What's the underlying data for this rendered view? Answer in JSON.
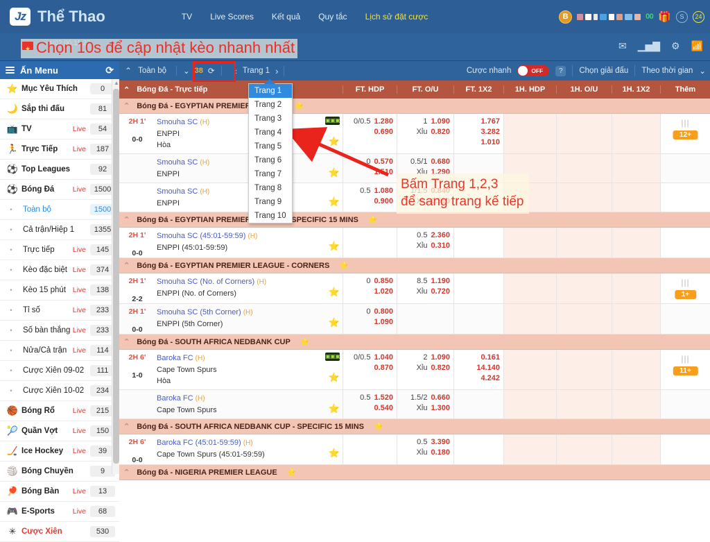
{
  "header": {
    "brand": "Thể Thao",
    "logo_text": "Jz",
    "nav": [
      {
        "label": "TV",
        "highlight": false
      },
      {
        "label": "Live Scores",
        "highlight": false
      },
      {
        "label": "Kết quả",
        "highlight": false
      },
      {
        "label": "Quy tắc",
        "highlight": false
      },
      {
        "label": "Lịch sử đặt cược",
        "highlight": true
      }
    ],
    "coin_letter": "B",
    "amount": "00",
    "icons": [
      "gift-icon",
      "s-circle-icon",
      "24-circle-icon"
    ],
    "clock": "4/02 00:11:27",
    "sub_icons": [
      "mail-icon",
      "stats-icon",
      "gear-icon",
      "wifi-icon"
    ]
  },
  "annotations": {
    "top": "Chọn 10s để cập nhật kèo nhanh nhất",
    "middle_line1": "Bấm Trang 1,2,3",
    "middle_line2": "để sang trang kế tiếp"
  },
  "sidebar": {
    "title": "Ấn Menu",
    "refresh_icon": "refresh-icon",
    "items": [
      {
        "icon": "star-icon",
        "label": "Mục Yêu Thích",
        "live": "",
        "count": "0",
        "sub": false
      },
      {
        "icon": "clock-icon",
        "label": "Sắp thi đấu",
        "live": "",
        "count": "81",
        "sub": false
      },
      {
        "icon": "tv-icon",
        "label": "TV",
        "live": "Live",
        "count": "54",
        "sub": false
      },
      {
        "icon": "running-icon",
        "label": "Trực Tiếp",
        "live": "Live",
        "count": "187",
        "sub": false
      },
      {
        "icon": "trophy-icon",
        "label": "Top Leagues",
        "live": "",
        "count": "92",
        "sub": false
      },
      {
        "icon": "soccer-icon",
        "label": "Bóng Đá",
        "live": "Live",
        "count": "1500",
        "sub": false
      },
      {
        "icon": "dot-icon",
        "label": "Toàn bộ",
        "live": "",
        "count": "1500",
        "sub": true,
        "active": true
      },
      {
        "icon": "dot-icon",
        "label": "Cả trận/Hiệp 1",
        "live": "",
        "count": "1355",
        "sub": true
      },
      {
        "icon": "dot-icon",
        "label": "Trực tiếp",
        "live": "Live",
        "count": "145",
        "sub": true
      },
      {
        "icon": "dot-icon",
        "label": "Kèo đặc biệt",
        "live": "Live",
        "count": "374",
        "sub": true
      },
      {
        "icon": "dot-icon",
        "label": "Kèo 15 phút",
        "live": "Live",
        "count": "138",
        "sub": true
      },
      {
        "icon": "dot-icon",
        "label": "Tỉ số",
        "live": "Live",
        "count": "233",
        "sub": true
      },
      {
        "icon": "dot-icon",
        "label": "Số bàn thắng",
        "live": "Live",
        "count": "233",
        "sub": true
      },
      {
        "icon": "dot-icon",
        "label": "Nửa/Cả trận",
        "live": "Live",
        "count": "114",
        "sub": true
      },
      {
        "icon": "dot-icon",
        "label": "Cược Xiên 09-02",
        "live": "",
        "count": "111",
        "sub": true
      },
      {
        "icon": "dot-icon",
        "label": "Cược Xiên 10-02",
        "live": "",
        "count": "234",
        "sub": true
      },
      {
        "icon": "basketball-icon",
        "label": "Bóng Rổ",
        "live": "Live",
        "count": "215",
        "sub": false
      },
      {
        "icon": "tennis-icon",
        "label": "Quần Vợt",
        "live": "Live",
        "count": "150",
        "sub": false
      },
      {
        "icon": "hockey-icon",
        "label": "Ice Hockey",
        "live": "Live",
        "count": "39",
        "sub": false
      },
      {
        "icon": "volleyball-icon",
        "label": "Bóng Chuyền",
        "live": "",
        "count": "9",
        "sub": false
      },
      {
        "icon": "pingpong-icon",
        "label": "Bóng Bàn",
        "live": "Live",
        "count": "13",
        "sub": false
      },
      {
        "icon": "gamepad-icon",
        "label": "E-Sports",
        "live": "Live",
        "count": "68",
        "sub": false
      },
      {
        "icon": "parlay-icon",
        "label": "Cược Xiên",
        "live": "",
        "count": "530",
        "sub": false,
        "red": true
      }
    ]
  },
  "toolbar": {
    "collapse_icon": "chevron-up-icon",
    "all_label": "Toàn bộ",
    "refresh_seconds": "38",
    "refresh_icon": "refresh-icon",
    "page_label": "Trang 1",
    "prev_icon": "chevron-left-icon",
    "next_icon": "chevron-right-icon",
    "quickbet_label": "Cược nhanh",
    "toggle_state": "OFF",
    "help_label": "?",
    "select_league": "Chọn giải đấu",
    "sort_by_time": "Theo thời gian"
  },
  "page_dropdown": {
    "selected": "Trang 1",
    "options": [
      "Trang 1",
      "Trang 2",
      "Trang 3",
      "Trang 4",
      "Trang 5",
      "Trang 6",
      "Trang 7",
      "Trang 8",
      "Trang 9",
      "Trang 10"
    ]
  },
  "table": {
    "section_title": "Bóng Đá - Trực tiếp",
    "columns": [
      "FT. HDP",
      "FT. O/U",
      "FT. 1X2",
      "1H. HDP",
      "1H. O/U",
      "1H. 1X2",
      "Thêm"
    ]
  },
  "groups": [
    {
      "league": "Bóng Đá - EGYPTIAN PREMIER LEAGUE",
      "matches": [
        {
          "time": "2H 1'",
          "score": "0-0",
          "teams": [
            {
              "name": "Smouha SC",
              "home": "(H)",
              "link": true
            },
            {
              "name": "ENPPI",
              "home": "",
              "link": false
            },
            {
              "name": "Hòa",
              "home": "",
              "link": false
            }
          ],
          "tv": true,
          "star": true,
          "ft_hdp": [
            {
              "hd": "0/0.5",
              "v": "1.280"
            },
            {
              "hd": "",
              "v": "0.690"
            }
          ],
          "ft_ou": [
            {
              "hd": "1",
              "v": "1.090"
            },
            {
              "hd": "Xỉu",
              "v": "0.820"
            }
          ],
          "ft_1x2": [
            {
              "hd": "",
              "v": "1.767"
            },
            {
              "hd": "",
              "v": "3.282"
            },
            {
              "hd": "",
              "v": "1.010"
            }
          ],
          "more_badge": "12+"
        },
        {
          "time": "",
          "score": "",
          "teams": [
            {
              "name": "Smouha SC",
              "home": "(H)",
              "link": true
            },
            {
              "name": "ENPPI",
              "home": "",
              "link": false
            }
          ],
          "tv": false,
          "star": true,
          "ft_hdp": [
            {
              "hd": "0",
              "v": "0.570"
            },
            {
              "hd": "",
              "v": "1.510"
            }
          ],
          "ft_ou": [
            {
              "hd": "0.5/1",
              "v": "0.680"
            },
            {
              "hd": "Xỉu",
              "v": "1.290"
            }
          ],
          "ft_1x2": [],
          "more_badge": ""
        },
        {
          "time": "",
          "score": "",
          "teams": [
            {
              "name": "Smouha SC",
              "home": "(H)",
              "link": true
            },
            {
              "name": "ENPPI",
              "home": "",
              "link": false
            }
          ],
          "tv": false,
          "star": true,
          "ft_hdp": [
            {
              "hd": "0.5",
              "v": "1.080"
            },
            {
              "hd": "",
              "v": "0.900"
            }
          ],
          "ft_ou": [
            {
              "hd": "1/1.5",
              "v": "0.840"
            },
            {
              "hd": "Xỉu",
              "v": "0.510"
            }
          ],
          "ft_1x2": [],
          "more_badge": ""
        }
      ]
    },
    {
      "league": "Bóng Đá - EGYPTIAN PREMIER LEAGUE - SPECIFIC 15 MINS",
      "matches": [
        {
          "time": "2H 1'",
          "score": "0-0",
          "teams": [
            {
              "name": "Smouha SC (45:01-59:59)",
              "home": "(H)",
              "link": true
            },
            {
              "name": "ENPPI (45:01-59:59)",
              "home": "",
              "link": false
            }
          ],
          "tv": false,
          "star": true,
          "ft_hdp": [],
          "ft_ou": [
            {
              "hd": "0.5",
              "v": "2.360"
            },
            {
              "hd": "Xỉu",
              "v": "0.310"
            }
          ],
          "ft_1x2": [],
          "more_badge": ""
        }
      ]
    },
    {
      "league": "Bóng Đá - EGYPTIAN PREMIER LEAGUE - CORNERS",
      "matches": [
        {
          "time": "2H 1'",
          "score": "2-2",
          "teams": [
            {
              "name": "Smouha SC (No. of Corners)",
              "home": "(H)",
              "link": true
            },
            {
              "name": "ENPPI (No. of Corners)",
              "home": "",
              "link": false
            }
          ],
          "tv": false,
          "star": true,
          "ft_hdp": [
            {
              "hd": "0",
              "v": "0.850"
            },
            {
              "hd": "",
              "v": "1.020"
            }
          ],
          "ft_ou": [
            {
              "hd": "8.5",
              "v": "1.190"
            },
            {
              "hd": "Xỉu",
              "v": "0.720"
            }
          ],
          "ft_1x2": [],
          "more_badge": "1+"
        },
        {
          "time": "2H 1'",
          "score": "0-0",
          "teams": [
            {
              "name": "Smouha SC (5th Corner)",
              "home": "(H)",
              "link": true
            },
            {
              "name": "ENPPI (5th Corner)",
              "home": "",
              "link": false
            }
          ],
          "tv": false,
          "star": true,
          "ft_hdp": [
            {
              "hd": "0",
              "v": "0.800"
            },
            {
              "hd": "",
              "v": "1.090"
            }
          ],
          "ft_ou": [],
          "ft_1x2": [],
          "more_badge": ""
        }
      ]
    },
    {
      "league": "Bóng Đá - SOUTH AFRICA NEDBANK CUP",
      "matches": [
        {
          "time": "2H 6'",
          "score": "1-0",
          "teams": [
            {
              "name": "Baroka FC",
              "home": "(H)",
              "link": true
            },
            {
              "name": "Cape Town Spurs",
              "home": "",
              "link": false
            },
            {
              "name": "Hòa",
              "home": "",
              "link": false
            }
          ],
          "tv": true,
          "star": true,
          "ft_hdp": [
            {
              "hd": "0/0.5",
              "v": "1.040"
            },
            {
              "hd": "",
              "v": "0.870"
            }
          ],
          "ft_ou": [
            {
              "hd": "2",
              "v": "1.090"
            },
            {
              "hd": "Xỉu",
              "v": "0.820"
            }
          ],
          "ft_1x2": [
            {
              "hd": "",
              "v": "0.161"
            },
            {
              "hd": "",
              "v": "14.140"
            },
            {
              "hd": "",
              "v": "4.242"
            }
          ],
          "more_badge": "11+"
        },
        {
          "time": "",
          "score": "",
          "teams": [
            {
              "name": "Baroka FC",
              "home": "(H)",
              "link": true
            },
            {
              "name": "Cape Town Spurs",
              "home": "",
              "link": false
            }
          ],
          "tv": false,
          "star": true,
          "ft_hdp": [
            {
              "hd": "0.5",
              "v": "1.520"
            },
            {
              "hd": "",
              "v": "0.540"
            }
          ],
          "ft_ou": [
            {
              "hd": "1.5/2",
              "v": "0.660"
            },
            {
              "hd": "Xỉu",
              "v": "1.300"
            }
          ],
          "ft_1x2": [],
          "more_badge": ""
        }
      ]
    },
    {
      "league": "Bóng Đá - SOUTH AFRICA NEDBANK CUP - SPECIFIC 15 MINS",
      "matches": [
        {
          "time": "2H 6'",
          "score": "0-0",
          "teams": [
            {
              "name": "Baroka FC (45:01-59:59)",
              "home": "(H)",
              "link": true
            },
            {
              "name": "Cape Town Spurs (45:01-59:59)",
              "home": "",
              "link": false
            }
          ],
          "tv": false,
          "star": true,
          "ft_hdp": [],
          "ft_ou": [
            {
              "hd": "0.5",
              "v": "3.390"
            },
            {
              "hd": "Xỉu",
              "v": "0.180"
            }
          ],
          "ft_1x2": [],
          "more_badge": ""
        }
      ]
    },
    {
      "league": "Bóng Đá - NIGERIA PREMIER LEAGUE",
      "matches": []
    }
  ]
}
